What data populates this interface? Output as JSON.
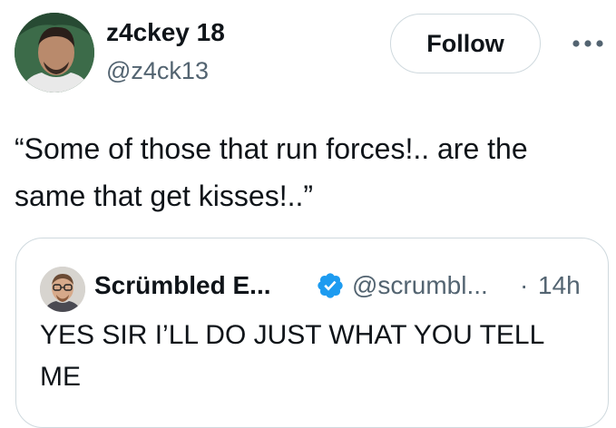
{
  "author": {
    "display_name": "z4ckey 18",
    "handle": "@z4ck13"
  },
  "follow_label": "Follow",
  "more_icon": "more-horizontal-icon",
  "tweet": {
    "text": "“Some of those that run forces!.. are the same that get kisses!..”"
  },
  "quoted_tweet": {
    "display_name": "Scrümbled E...",
    "verified_icon": "verified-badge-icon",
    "handle": "@scrumbl...",
    "separator": "·",
    "time": "14h",
    "text": "YES SIR I’LL DO JUST WHAT YOU TELL ME"
  },
  "colors": {
    "text_primary": "#0f1419",
    "text_secondary": "#536471",
    "border": "#cfd9de",
    "verified_blue": "#1d9bf0",
    "background": "#ffffff"
  }
}
